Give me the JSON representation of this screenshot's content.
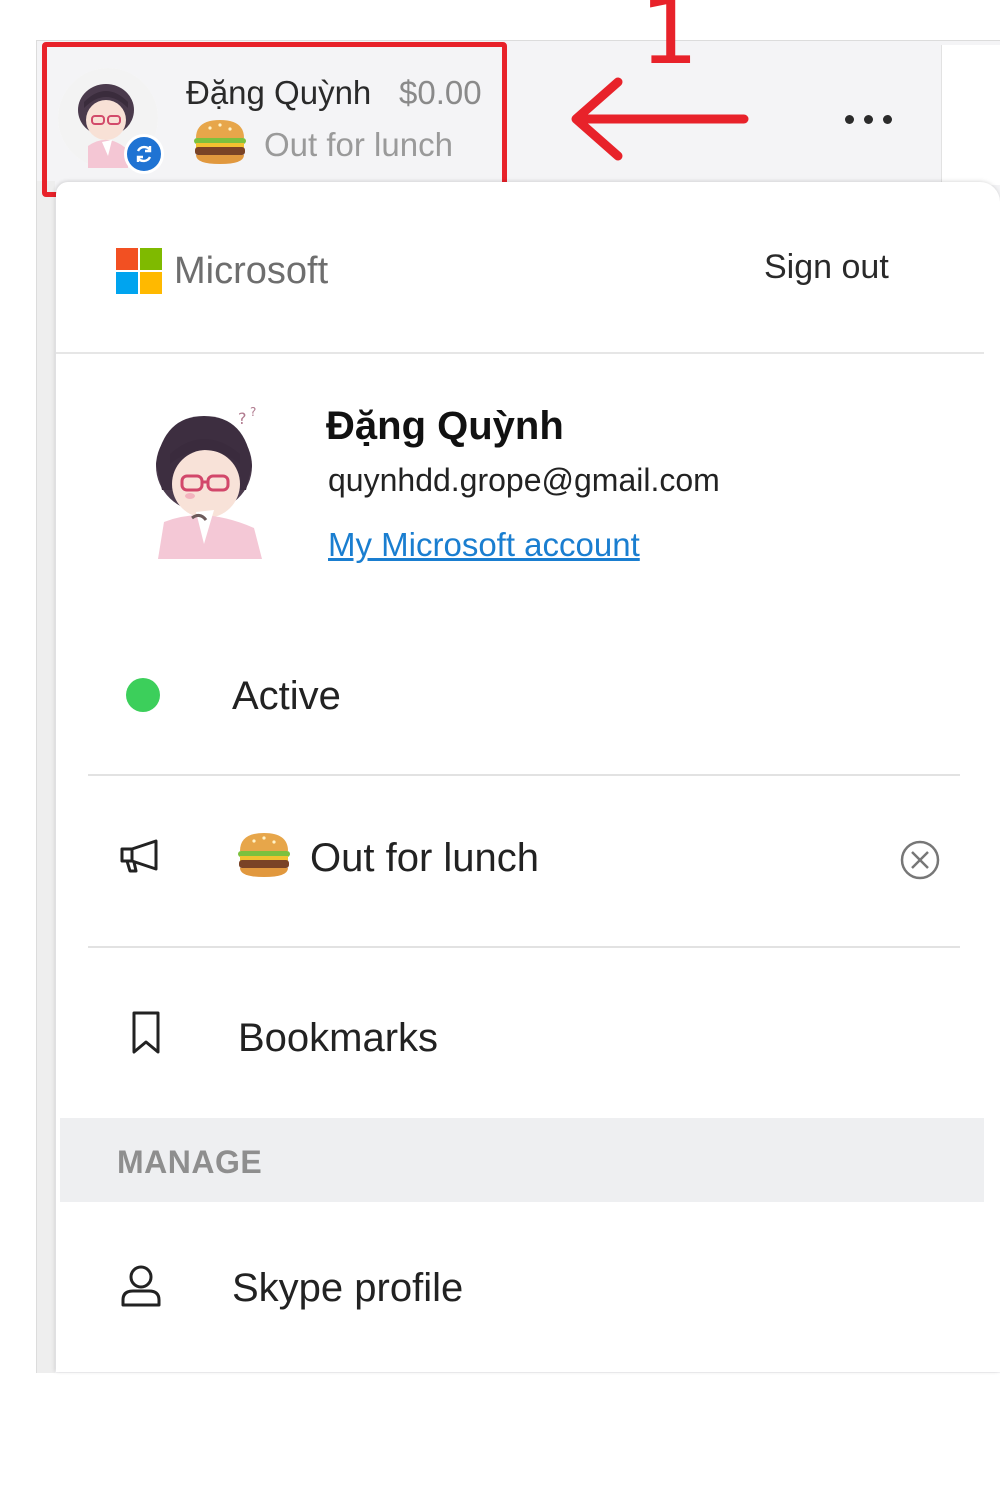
{
  "header": {
    "name": "Đặng Quỳnh",
    "credit": "$0.00",
    "mood": "Out for lunch"
  },
  "annotation": {
    "number": "1",
    "color": "#e8222a"
  },
  "panel": {
    "brand": "Microsoft",
    "sign_out": "Sign out",
    "profile": {
      "name": "Đặng Quỳnh",
      "email": "quynhdd.grope@gmail.com",
      "account_link": "My Microsoft account"
    },
    "status": {
      "label": "Active",
      "color": "#3ccf5b"
    },
    "mood": {
      "label": "Out for lunch"
    },
    "bookmarks": {
      "label": "Bookmarks"
    },
    "manage_header": "MANAGE",
    "skype_profile": {
      "label": "Skype profile"
    }
  },
  "icons": [
    "sync-icon",
    "more-options-icon",
    "megaphone-icon",
    "clear-icon",
    "bookmark-icon",
    "person-icon",
    "burger-emoji-icon"
  ],
  "colors": {
    "ms_red": "#f25022",
    "ms_green": "#7fba00",
    "ms_blue": "#00a4ef",
    "ms_yellow": "#ffb900",
    "link": "#1a7ed0",
    "sync_badge": "#1f73d3"
  }
}
